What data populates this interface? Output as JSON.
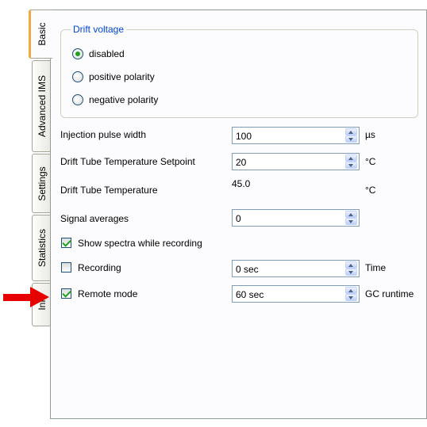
{
  "tabs": [
    "Basic",
    "Advanced IMS",
    "Settings",
    "Statistics",
    "Inf"
  ],
  "drift_voltage": {
    "title": "Drift voltage",
    "options": [
      "disabled",
      "positive polarity",
      "negative polarity"
    ],
    "selected": "disabled"
  },
  "fields": {
    "injection_pulse_width": {
      "label": "Injection pulse width",
      "value": "100",
      "unit": "µs"
    },
    "setpoint": {
      "label": "Drift Tube Temperature Setpoint",
      "value": "20",
      "unit": "°C"
    },
    "temperature": {
      "label": "Drift Tube Temperature",
      "value": "45.0",
      "unit": "°C"
    },
    "signal_averages": {
      "label": "Signal averages",
      "value": "0"
    },
    "show_spectra": {
      "label": "Show spectra while recording",
      "checked": true
    },
    "recording": {
      "label": "Recording",
      "checked": false,
      "value": "0 sec",
      "unit": "Time"
    },
    "remote_mode": {
      "label": "Remote mode",
      "checked": true,
      "value": "60 sec",
      "unit": "GC runtime"
    }
  },
  "colors": {
    "annotation": "#c00000",
    "arrow": "#e60000",
    "active_tab_accent": "#f0a93c"
  }
}
